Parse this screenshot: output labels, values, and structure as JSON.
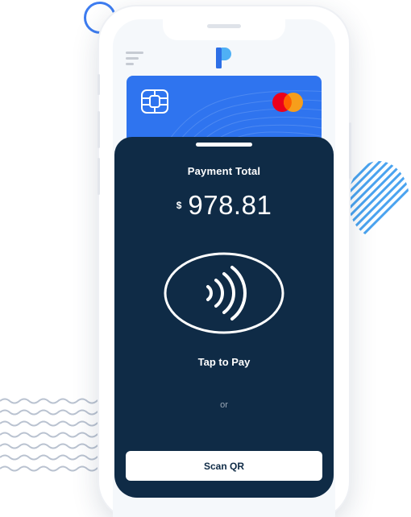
{
  "payment": {
    "title": "Payment Total",
    "currency_symbol": "$",
    "amount": "978.81"
  },
  "tap": {
    "label": "Tap to Pay"
  },
  "divider": {
    "label": "or"
  },
  "scan_button": {
    "label": "Scan QR"
  },
  "icons": {
    "menu": "hamburger-menu-icon",
    "logo": "p-logo-icon",
    "chip": "card-chip-icon",
    "card_brand": "mastercard-logo",
    "contactless": "contactless-icon"
  },
  "colors": {
    "sheet": "#0f2b46",
    "card": "#2f74ef",
    "accent": "#3d7cf0",
    "mastercard_red": "#eb001b",
    "mastercard_orange": "#f79e1b"
  }
}
